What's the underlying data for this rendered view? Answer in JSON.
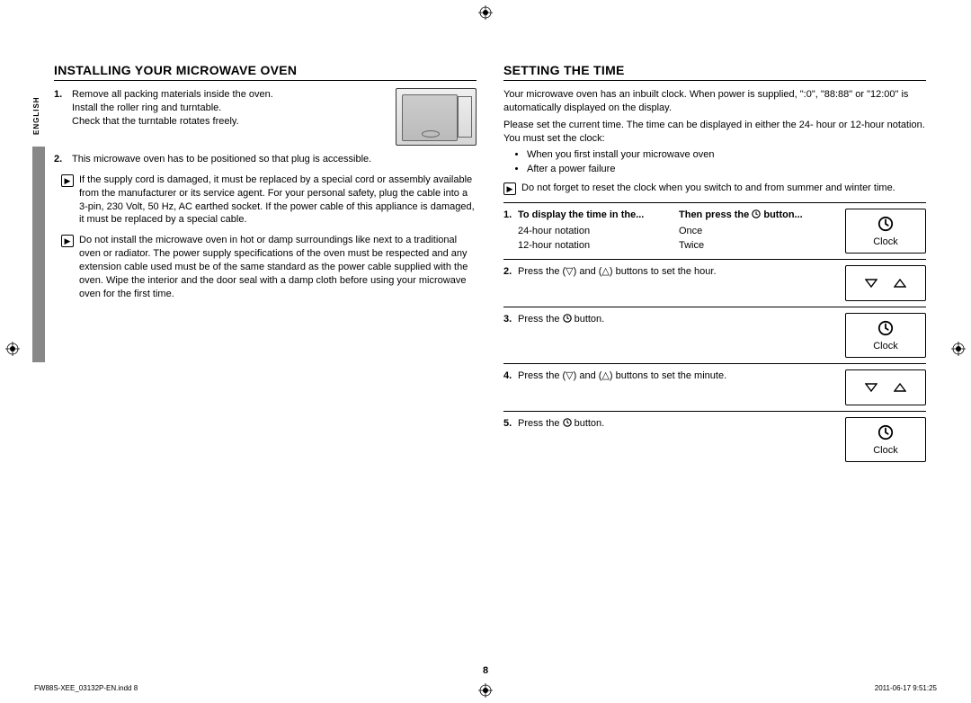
{
  "sideLabel": "ENGLISH",
  "pageNumber": "8",
  "footerLeft": "FW88S-XEE_03132P-EN.indd   8",
  "footerRight": "2011-06-17     9:51:25",
  "left": {
    "heading": "INSTALLING YOUR MICROWAVE OVEN",
    "step1a": "Remove all packing materials inside the oven.",
    "step1b": "Install the roller ring and turntable.",
    "step1c": "Check that the turntable rotates freely.",
    "step2": "This microwave oven has to be positioned so that plug is accessible.",
    "warn1": "If the supply cord is damaged, it must be replaced by a special cord or assembly available from the manufacturer or its service agent. For your personal safety, plug the cable into a 3-pin, 230 Volt, 50 Hz, AC earthed socket. If the power cable of this appliance is damaged, it must be replaced by a special cable.",
    "warn2": "Do not install the microwave oven in hot or damp surroundings like next to a traditional oven or radiator. The power supply specifications of the oven must be respected and any extension cable used must be of the same standard as the power cable supplied with the oven. Wipe the interior and the door seal with a damp cloth before using your microwave oven for the first time."
  },
  "right": {
    "heading": "SETTING THE TIME",
    "intro1": "Your microwave oven has an inbuilt clock. When power is supplied, \":0\", \"88:88\" or \"12:00\" is automatically displayed on the display.",
    "intro2": "Please set the current time. The time can be displayed in either the 24- hour or 12-hour notation. You must set the clock:",
    "bullet1": "When you first install your microwave oven",
    "bullet2": "After a power failure",
    "note": "Do not forget to reset the clock when you switch to and from summer and winter time.",
    "tableHead1": "To display the time in the...",
    "tableHead2a": "Then press the ",
    "tableHead2b": " button...",
    "row1a": "24-hour notation",
    "row1b": "Once",
    "row2a": "12-hour notation",
    "row2b": "Twice",
    "step2": "Press the (▽) and (△) buttons to set the hour.",
    "step3a": "Press the ",
    "step3b": " button.",
    "step4": "Press the (▽) and (△) buttons to set the minute.",
    "step5a": "Press the ",
    "step5b": " button.",
    "clockLabel": "Clock"
  }
}
